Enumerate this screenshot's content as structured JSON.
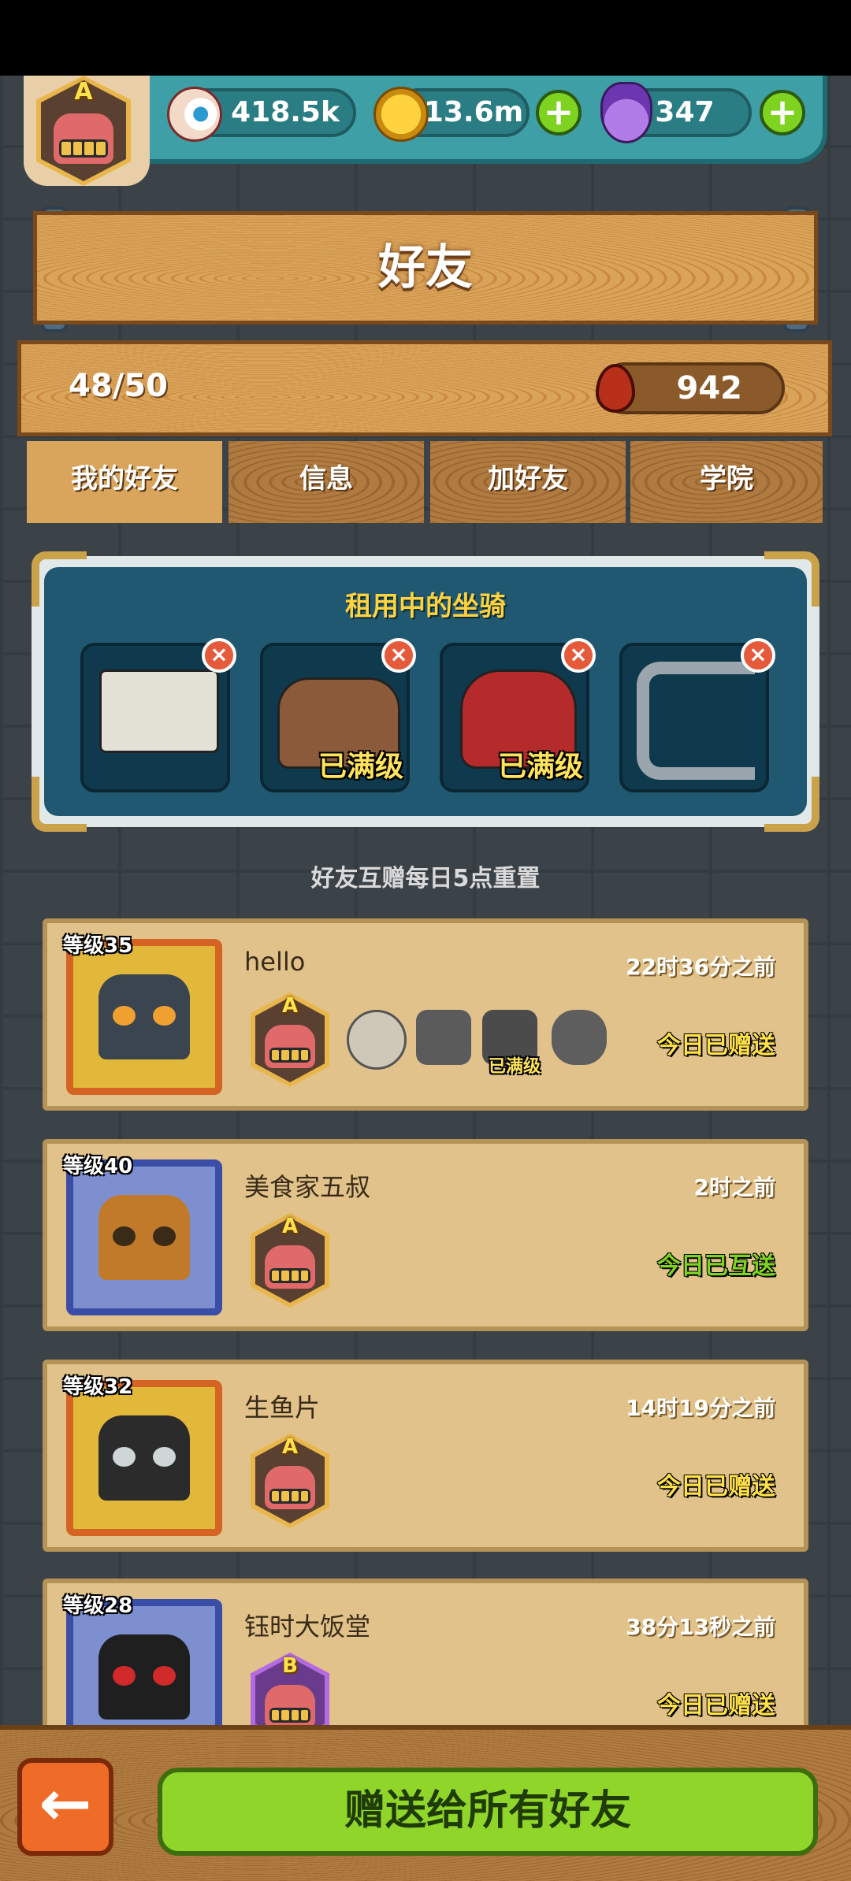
{
  "resources": {
    "eyeballs": "418.5k",
    "coins": "13.6m",
    "potions": "347",
    "plus_symbol": "+"
  },
  "player_badge_letter": "A",
  "header": {
    "title": "好友"
  },
  "friends_count": "48/50",
  "blood_count": "942",
  "tabs": [
    {
      "label": "我的好友",
      "selected": true
    },
    {
      "label": "信息"
    },
    {
      "label": "加好友"
    },
    {
      "label": "学院"
    }
  ],
  "rented_mounts": {
    "title": "租用中的坐骑",
    "slots": [
      {
        "maxed_label": ""
      },
      {
        "maxed_label": "已满级"
      },
      {
        "maxed_label": "已满级"
      },
      {
        "maxed_label": ""
      }
    ],
    "close_symbol": "×"
  },
  "reset_note": "好友互赠每日5点重置",
  "friends": [
    {
      "level": "等级35",
      "name": "hello",
      "time": "22时36分之前",
      "status": "今日已赠送",
      "status_color": "#ffe14a",
      "badge": "A",
      "frame_color": "#d46324",
      "bg_color": "#e2b83a",
      "maxed_label": "已满级"
    },
    {
      "level": "等级40",
      "name": "美食家五叔",
      "time": "2时之前",
      "status": "今日已互送",
      "status_color": "#7ed321",
      "badge": "A",
      "frame_color": "#3a4ea8",
      "bg_color": "#7e8fd0",
      "maxed_label": ""
    },
    {
      "level": "等级32",
      "name": "生鱼片",
      "time": "14时19分之前",
      "status": "今日已赠送",
      "status_color": "#ffe14a",
      "badge": "A",
      "frame_color": "#d46324",
      "bg_color": "#e2b83a",
      "maxed_label": ""
    },
    {
      "level": "等级28",
      "name": "钰时大饭堂",
      "time": "38分13秒之前",
      "status": "今日已赠送",
      "status_color": "#ffe14a",
      "badge": "B",
      "frame_color": "#3a4ea8",
      "bg_color": "#7e8fd0",
      "maxed_label": ""
    }
  ],
  "bottom": {
    "back_symbol": "←",
    "send_all_label": "赠送给所有好友"
  }
}
